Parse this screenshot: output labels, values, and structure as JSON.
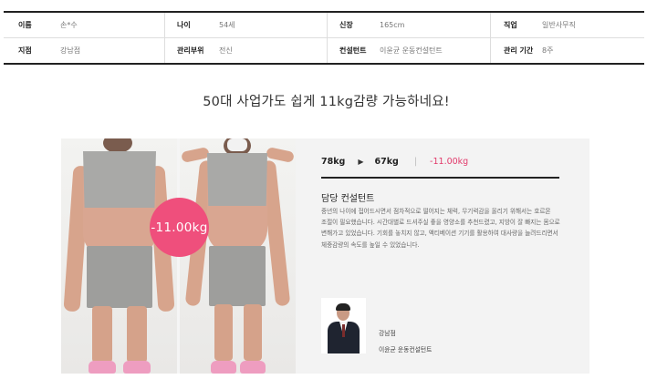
{
  "info": {
    "row1": [
      {
        "label": "이름",
        "value": "손*수"
      },
      {
        "label": "나이",
        "value": "54세"
      },
      {
        "label": "신장",
        "value": "165cm"
      },
      {
        "label": "직업",
        "value": "일반사무직"
      }
    ],
    "row2": [
      {
        "label": "지점",
        "value": "강남점"
      },
      {
        "label": "관리부위",
        "value": "전신"
      },
      {
        "label": "컨설턴트",
        "value": "이윤균 운동컨설턴트"
      },
      {
        "label": "관리 기간",
        "value": "8주"
      }
    ]
  },
  "headline": "50대 사업가도 쉽게 11kg감량 가능하네요!",
  "badge": "-11.00kg",
  "result": {
    "before": "78kg",
    "after": "67kg",
    "loss": "-11.00kg",
    "arrow_icon": "triangle-right",
    "separator": "|",
    "accent_color": "#e23a6b"
  },
  "consultant": {
    "title": "담당 컨설턴트",
    "comment": "중년의 나이에 접어드시면서 점차적으로 떨어지는 체력, 무기력감을 올리기 위해서는 호르몬 조절이 필요했습니다. 시간대별로 드셔주실 좋을 영양소를 추천드렸고, 지방이 잘 빠지는 몸으로 변해가고 있었습니다. 기회를 놓치지 않고, 액티베이션 기기를 활용하여 대사량을 늘려드리면서 체중감량의 속도를 높일 수 있었습니다.",
    "branch": "강남점",
    "name": "이윤균 운동컨설턴트"
  }
}
